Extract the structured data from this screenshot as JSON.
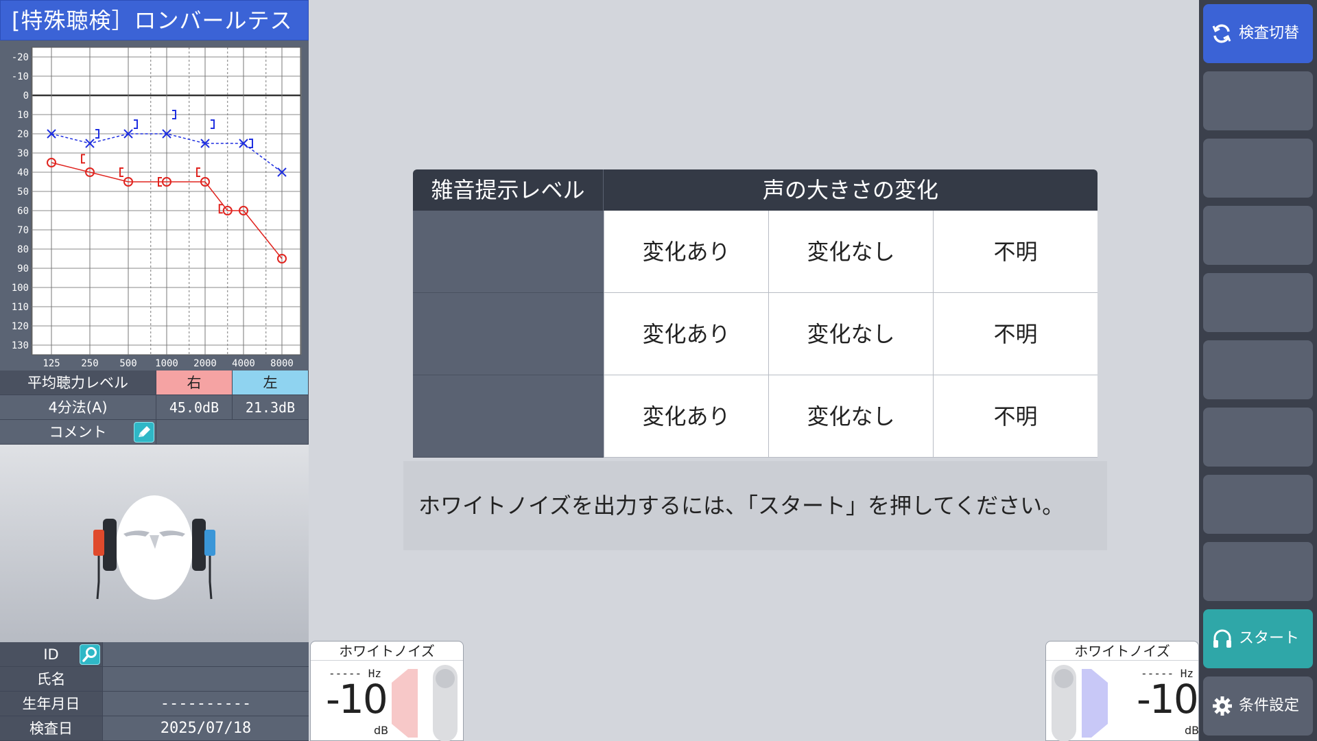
{
  "title": "[特殊聴検］ロンバールテスト",
  "audiogram": {
    "y_ticks": [
      "-20",
      "-10",
      "0",
      "10",
      "20",
      "30",
      "40",
      "50",
      "60",
      "70",
      "80",
      "90",
      "100",
      "110",
      "120",
      "130"
    ],
    "x_ticks": [
      "125",
      "250",
      "500",
      "1000",
      "2000",
      "4000",
      "8000"
    ],
    "right_ac": [
      [
        125,
        35
      ],
      [
        250,
        40
      ],
      [
        500,
        45
      ],
      [
        1000,
        45
      ],
      [
        2000,
        45
      ],
      [
        3000,
        60
      ],
      [
        4000,
        60
      ],
      [
        8000,
        85
      ]
    ],
    "left_ac": [
      [
        125,
        20
      ],
      [
        250,
        25
      ],
      [
        500,
        20
      ],
      [
        1000,
        20
      ],
      [
        2000,
        25
      ],
      [
        4000,
        25
      ],
      [
        8000,
        40
      ]
    ],
    "right_bc": [
      [
        250,
        33
      ],
      [
        500,
        40
      ],
      [
        1000,
        45
      ],
      [
        2000,
        40
      ],
      [
        3000,
        59
      ]
    ],
    "left_bc": [
      [
        250,
        20
      ],
      [
        500,
        15
      ],
      [
        1000,
        10
      ],
      [
        2000,
        15
      ],
      [
        4000,
        25
      ]
    ],
    "right_color": "#e0241f",
    "left_color": "#1f2fe0"
  },
  "avg": {
    "header_label": "平均聴力レベル",
    "right_label": "右",
    "left_label": "左",
    "method": "4分法(A)",
    "right_value": "45.0dB",
    "left_value": "21.3dB",
    "comment_label": "コメント"
  },
  "patient": {
    "id_label": "ID",
    "id_value": "",
    "name_label": "氏名",
    "name_value": "",
    "birth_label": "生年月日",
    "birth_value": "----------",
    "date_label": "検査日",
    "date_value": "2025/07/18"
  },
  "table": {
    "col1_header": "雑音提示レベル",
    "col2_header": "声の大きさの変化",
    "rows": [
      {
        "level": "",
        "opt1": "変化あり",
        "opt2": "変化なし",
        "opt3": "不明"
      },
      {
        "level": "",
        "opt1": "変化あり",
        "opt2": "変化なし",
        "opt3": "不明"
      },
      {
        "level": "",
        "opt1": "変化あり",
        "opt2": "変化なし",
        "opt3": "不明"
      }
    ]
  },
  "message": "ホワイトノイズを出力するには、「スタート」を押してください。",
  "noise_right": {
    "title": "ホワイトノイズ",
    "hz": "----- Hz",
    "level": "-10",
    "unit": "dB",
    "color": "#f7c8c8"
  },
  "noise_left": {
    "title": "ホワイトノイズ",
    "hz": "----- Hz",
    "level": "-10",
    "unit": "dB",
    "color": "#c8c8f7"
  },
  "sidebar": {
    "switch_label": "検査切替",
    "start_label": "スタート",
    "settings_label": "条件設定"
  }
}
